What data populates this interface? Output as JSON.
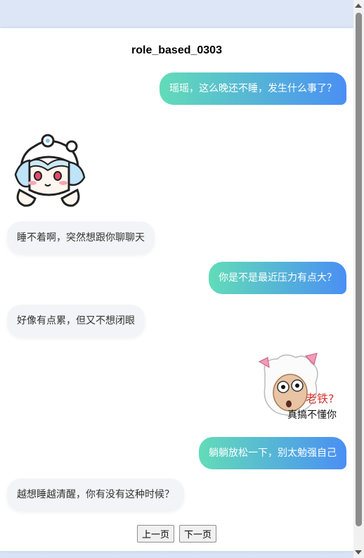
{
  "chat": {
    "title": "role_based_0303",
    "messages": [
      {
        "role": "user",
        "text": "瑶瑶，这么晚还不睡，发生什么事了？"
      },
      {
        "role": "assistant",
        "sticker": "anime-girl-sticker"
      },
      {
        "role": "assistant",
        "text": "睡不着啊，突然想跟你聊聊天"
      },
      {
        "role": "user",
        "text": "你是不是最近压力有点大？"
      },
      {
        "role": "assistant",
        "text": "好像有点累，但又不想闭眼"
      },
      {
        "role": "user",
        "sticker": "sheep-meme-sticker",
        "sticker_text": [
          "老铁?",
          "真搞不懂你"
        ]
      },
      {
        "role": "user",
        "text": "躺躺放松一下，别太勉强自己"
      },
      {
        "role": "assistant",
        "text": "越想睡越清醒，你有没有这种时候？"
      }
    ]
  },
  "pager": {
    "prev_label": "上一页",
    "next_label": "下一页"
  },
  "colors": {
    "user_bubble_start": "#62dcb8",
    "user_bubble_end": "#4a8ff4",
    "assistant_bubble": "#f2f4f7"
  }
}
